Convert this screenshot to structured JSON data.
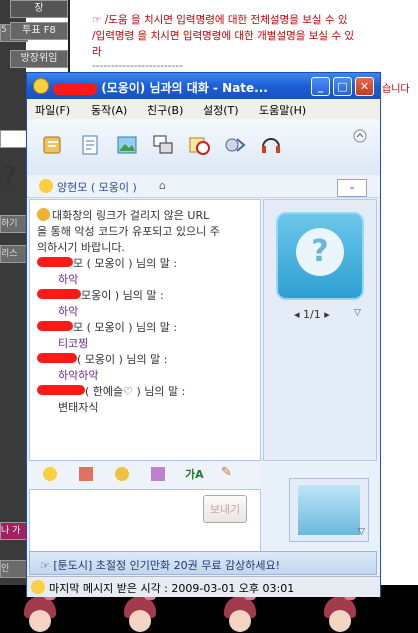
{
  "background": {
    "left_buttons": [
      "5",
      "하기",
      "리스",
      "나 가"
    ],
    "left_labels": {
      "ques": "?",
      "bottom": "인"
    },
    "top_buttons": [
      "투표 F8",
      "방장위임",
      "장"
    ],
    "notices": [
      "☞ /도움 을 치시면 입력명령에 대한 전체설명을 보실 수 있",
      "/입력명령 을 치시면 입력명령에 대한 개별설명을 보실 수 있",
      "라"
    ],
    "divider": "------------------------",
    "fragment_right": "습니다"
  },
  "window": {
    "title_suffix": "(모옹이) 님과의 대화  - Nate...",
    "menu": [
      "파일(F)",
      "동작(A)",
      "친구(B)",
      "설정(T)",
      "도움말(H)"
    ],
    "contact": "양현모 ( 모옹이 )",
    "chat": {
      "warning_line1": "대화창의 링크가 걸리지 않은 URL",
      "warning_line2": "을 통해 악성 코드가 유포되고 있으니 주",
      "warning_line3": "의하시기 바랍니다.",
      "messages": [
        {
          "speaker_suffix": "모 ( 모옹이 ) 님의 말 :",
          "text": "하악"
        },
        {
          "speaker_suffix": "모옹이 ) 님의 말 :",
          "text": "하악"
        },
        {
          "speaker_suffix": "모 ( 모옹이 ) 님의 말 :",
          "text": "티코찡"
        },
        {
          "speaker_suffix": "( 모옹이 ) 님의 말 :",
          "text": "하악하악"
        },
        {
          "speaker_suffix": "( 한예슬♡ ) 님의 말 :",
          "text": "변태자식"
        }
      ]
    },
    "avatar_pager": "1/1",
    "send_label": "보내기",
    "ad_text": "☞ [툰도시] 초절정 인기만화 20권 무료 감상하세요!",
    "status_text": "마지막 메시지 받은 시각 : 2009-03-01 오후 03:01"
  }
}
